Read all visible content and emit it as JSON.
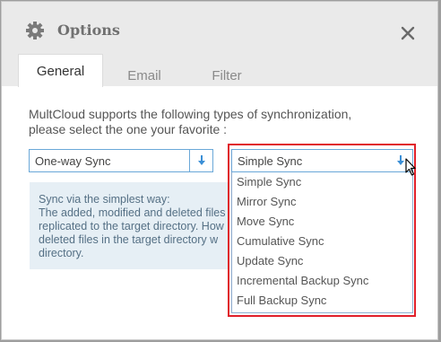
{
  "dialog": {
    "title": "Options",
    "close_icon": "close-icon",
    "gear_icon": "gear-icon"
  },
  "tabs": [
    {
      "label": "General",
      "active": true
    },
    {
      "label": "Email",
      "active": false
    },
    {
      "label": "Filter",
      "active": false
    }
  ],
  "description": {
    "line1": "MultCloud supports the following types of synchronization,",
    "line2": "please select the one your favorite :"
  },
  "sync_direction": {
    "value": "One-way Sync"
  },
  "sync_type": {
    "value": "Simple Sync",
    "options": [
      "Simple Sync",
      "Mirror Sync",
      "Move Sync",
      "Cumulative Sync",
      "Update Sync",
      "Incremental Backup Sync",
      "Full Backup Sync"
    ]
  },
  "info": {
    "line1": "Sync via the simplest way:",
    "line2": "The added, modified and deleted files",
    "line3": "replicated to the target directory. How",
    "line4": "deleted files in the target directory w",
    "line5": "directory."
  },
  "colors": {
    "highlight_border": "#e0202a",
    "select_border": "#6aa8d8",
    "arrow_blue": "#3b8fd6"
  }
}
